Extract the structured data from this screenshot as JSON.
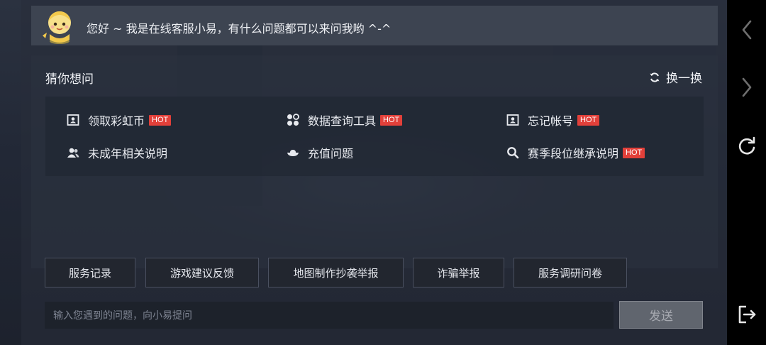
{
  "greeting": {
    "text": "您好 ~ 我是在线客服小易，有什么问题都可以来问我哟 ^-^"
  },
  "guess": {
    "title": "猜你想问",
    "refresh_label": "换一换",
    "hot_badge": "HOT",
    "items": [
      {
        "label": "领取彩虹币",
        "icon": "id-card-icon",
        "hot": true
      },
      {
        "label": "数据查询工具",
        "icon": "grid-apps-icon",
        "hot": true
      },
      {
        "label": "忘记帐号",
        "icon": "id-card-icon",
        "hot": true
      },
      {
        "label": "未成年相关说明",
        "icon": "users-icon",
        "hot": false
      },
      {
        "label": "充值问题",
        "icon": "ingot-icon",
        "hot": false
      },
      {
        "label": "赛季段位继承说明",
        "icon": "search-icon",
        "hot": true
      }
    ]
  },
  "quick_actions": [
    "服务记录",
    "游戏建议反馈",
    "地图制作抄袭举报",
    "诈骗举报",
    "服务调研问卷"
  ],
  "composer": {
    "placeholder": "输入您遇到的问题，向小易提问",
    "send_label": "发送"
  },
  "side_nav": [
    "back-icon",
    "forward-icon",
    "refresh-icon",
    "exit-icon"
  ],
  "colors": {
    "hot_badge": "#e2403a",
    "panel_bg": "#3d4451",
    "send_button": "#60656e"
  }
}
